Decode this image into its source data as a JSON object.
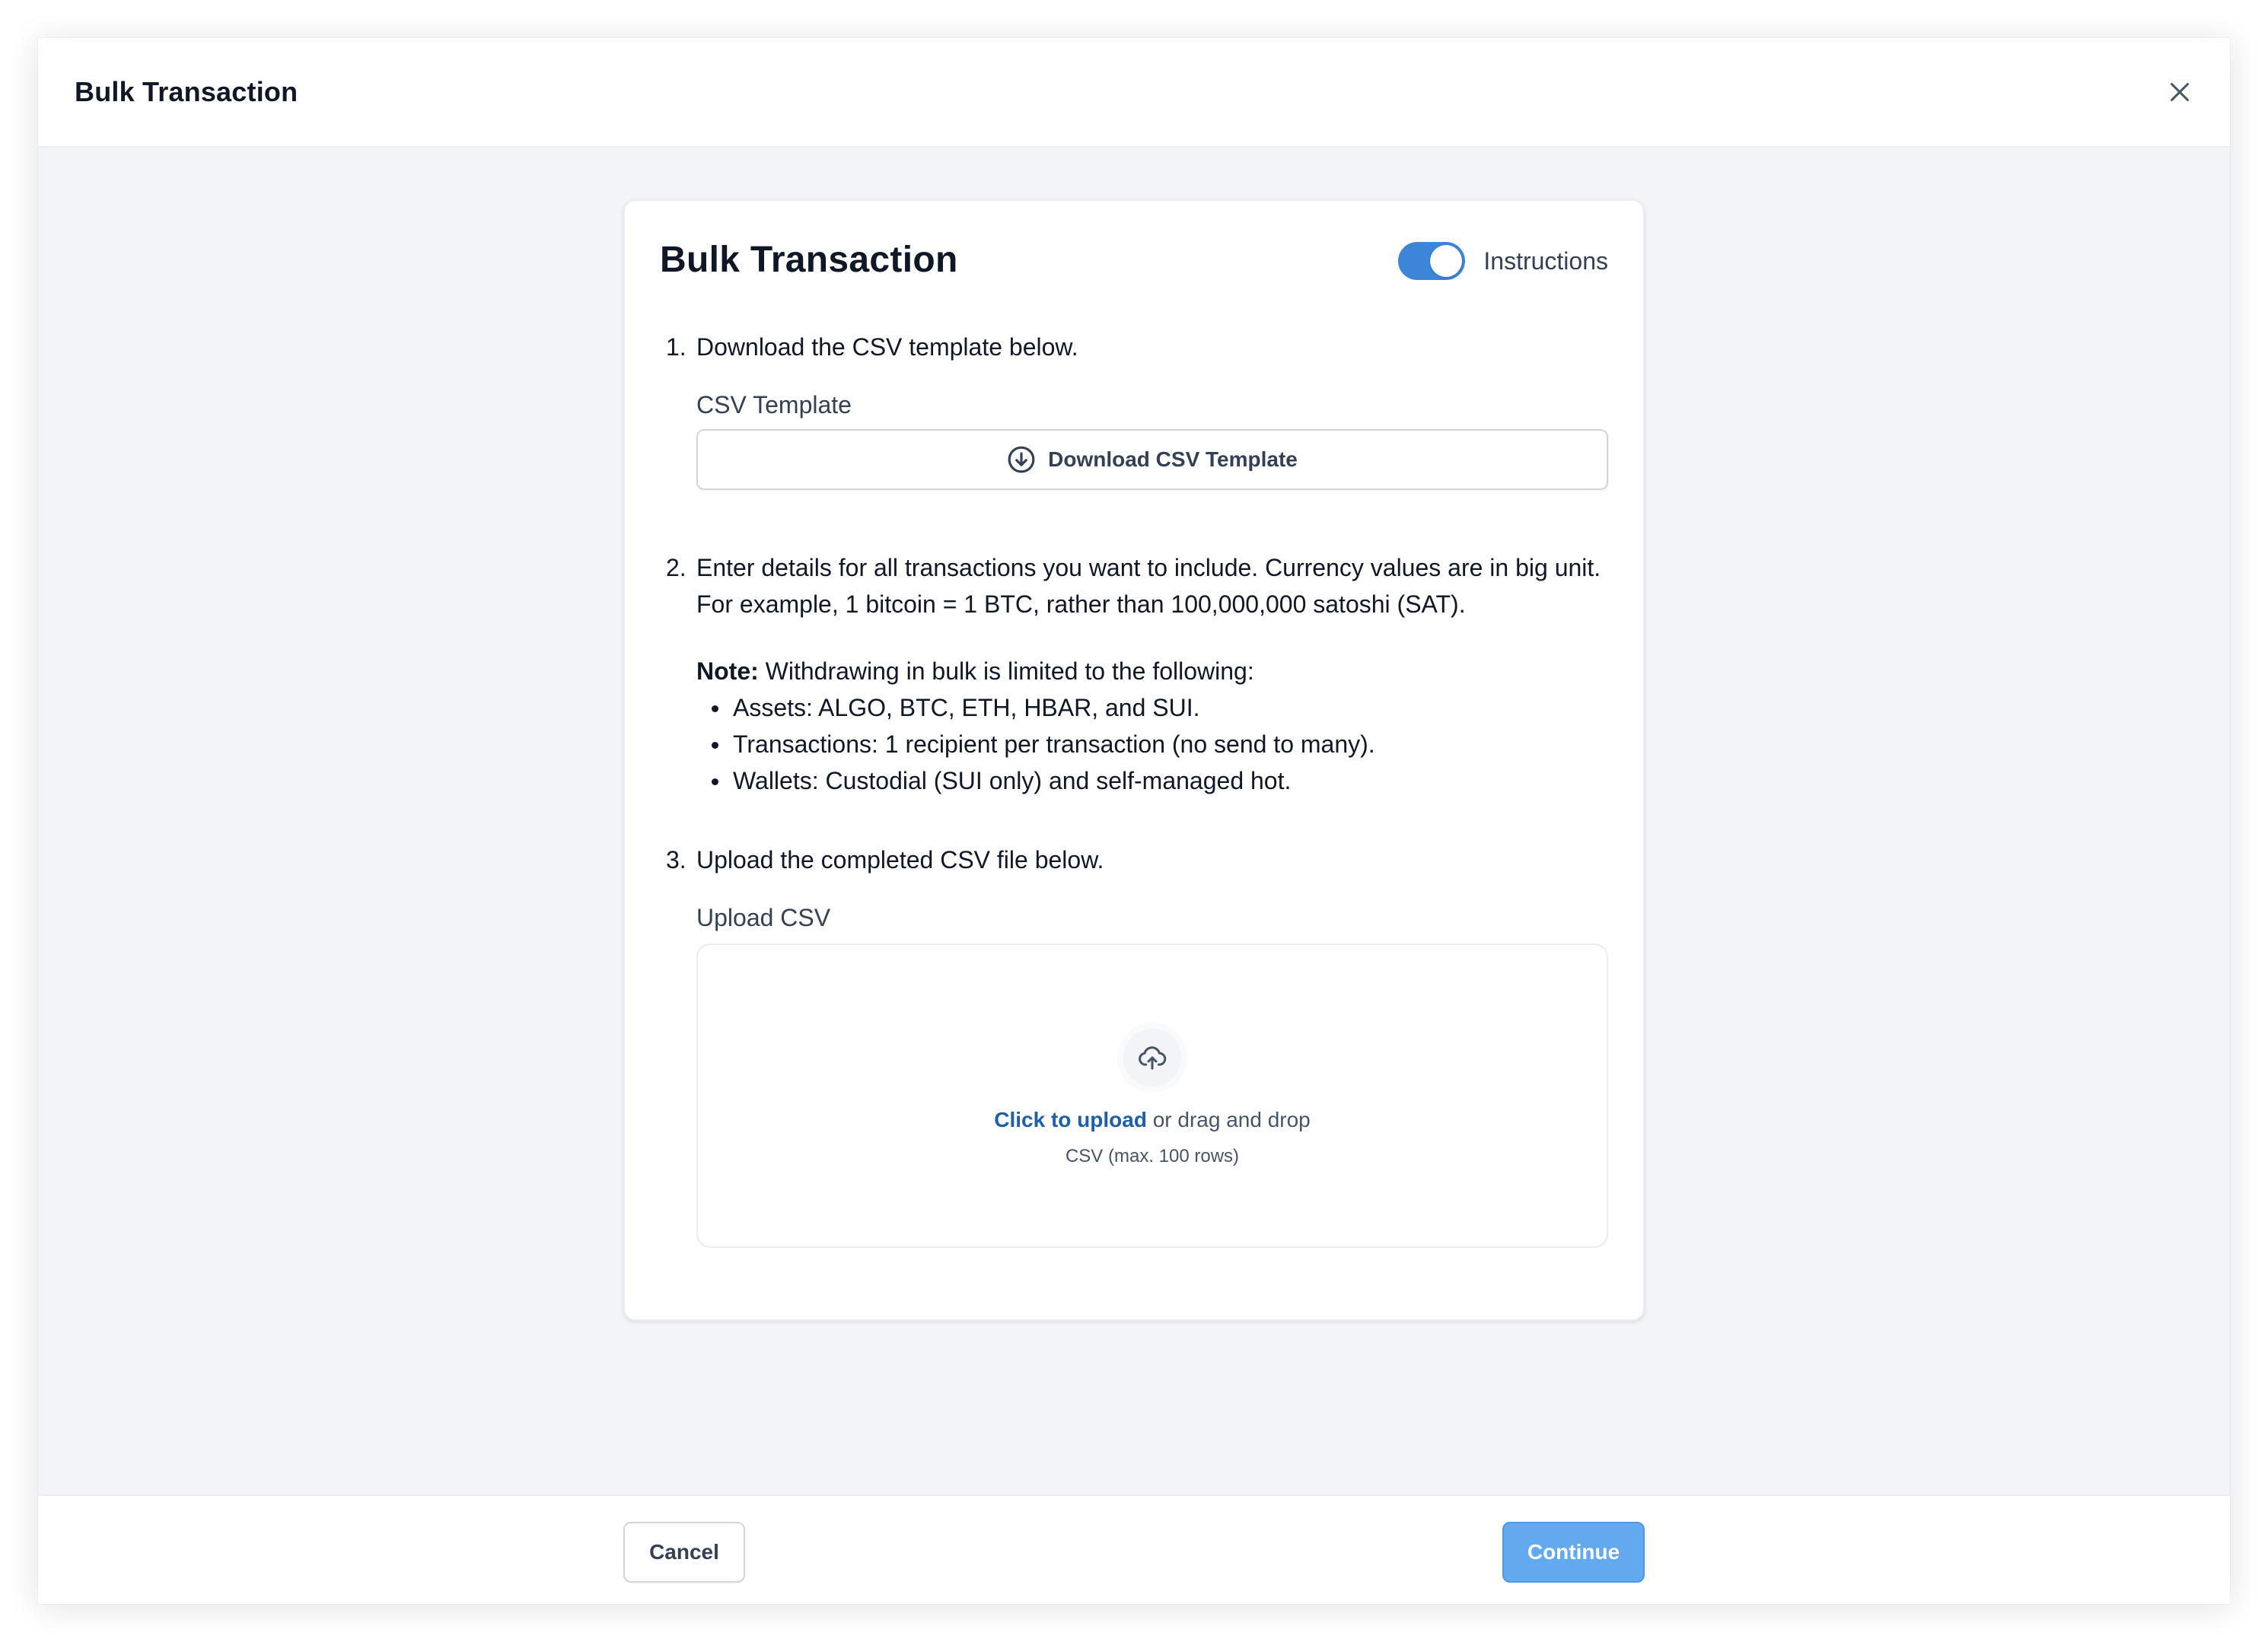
{
  "modal": {
    "title": "Bulk Transaction",
    "close_icon": "close-icon"
  },
  "card": {
    "title": "Bulk Transaction",
    "instructions_toggle": {
      "label": "Instructions",
      "on": true
    },
    "step1": {
      "number": "1.",
      "text": "Download the CSV template below.",
      "field_label": "CSV Template",
      "download_button_label": "Download CSV Template",
      "download_icon": "download-circle-icon"
    },
    "step2": {
      "number": "2.",
      "text": "Enter details for all transactions you want to include. Currency values are in big unit. For example, 1 bitcoin = 1 BTC, rather than 100,000,000 satoshi (SAT).",
      "note_label": "Note:",
      "note_text": " Withdrawing in bulk is limited to the following:",
      "bullets": [
        "Assets: ALGO, BTC, ETH, HBAR, and SUI.",
        "Transactions: 1 recipient per transaction (no send to many).",
        "Wallets: Custodial (SUI only) and self-managed hot."
      ]
    },
    "step3": {
      "number": "3.",
      "text": "Upload the completed CSV file below.",
      "field_label": "Upload CSV",
      "upload_icon": "cloud-upload-icon",
      "upload_link": "Click to upload",
      "upload_rest": " or drag and drop",
      "upload_hint": "CSV (max. 100 rows)"
    }
  },
  "footer": {
    "cancel_label": "Cancel",
    "continue_label": "Continue"
  },
  "colors": {
    "accent": "#3c85d8",
    "continue_bg": "#63a9f0",
    "link": "#1d5fa8",
    "background": "#f2f4f7"
  }
}
